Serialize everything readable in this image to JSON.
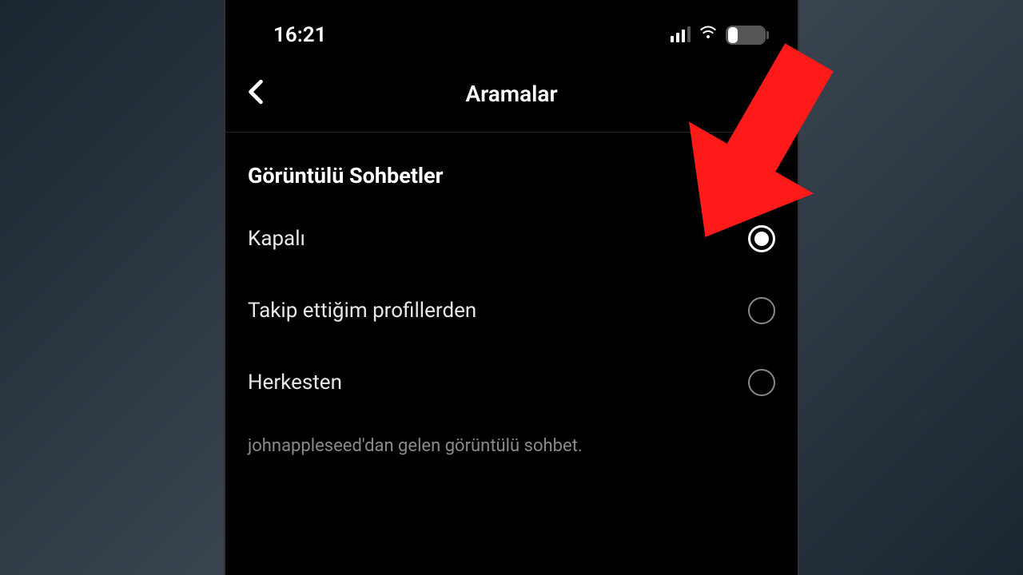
{
  "status_bar": {
    "time": "16:21",
    "battery_percent": "27"
  },
  "header": {
    "title": "Aramalar"
  },
  "section": {
    "title": "Görüntülü Sohbetler",
    "options": [
      {
        "label": "Kapalı",
        "selected": true
      },
      {
        "label": "Takip ettiğim profillerden",
        "selected": false
      },
      {
        "label": "Herkesten",
        "selected": false
      }
    ],
    "footer": "johnappleseed'dan gelen görüntülü sohbet."
  },
  "annotation": {
    "arrow_color": "#ff1a1a"
  }
}
